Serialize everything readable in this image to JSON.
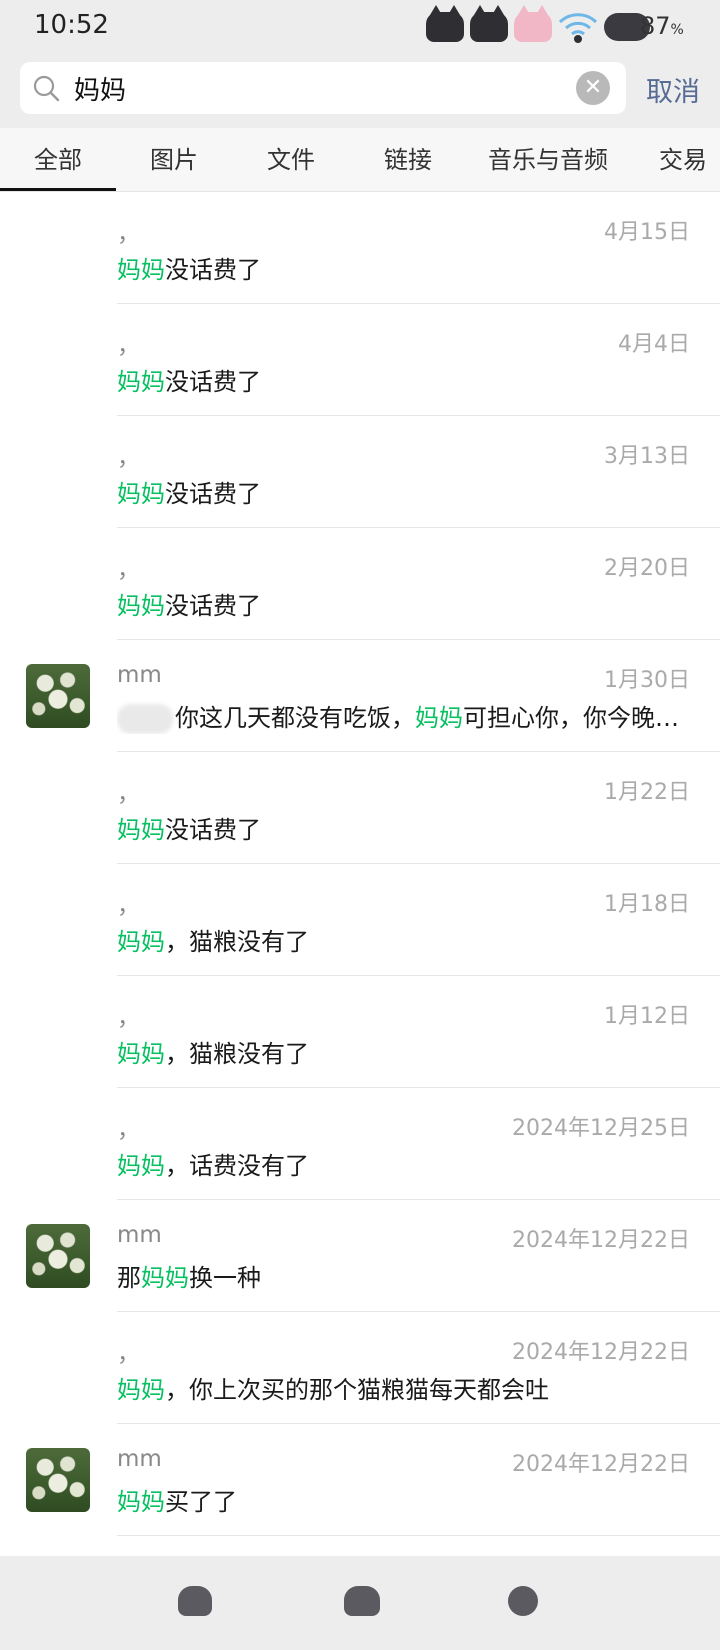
{
  "status": {
    "time": "10:52",
    "battery": "87",
    "battery_unit": "%"
  },
  "search": {
    "query": "妈妈",
    "placeholder": "",
    "cancel_label": "取消"
  },
  "tabs": [
    {
      "label": "全部",
      "active": true
    },
    {
      "label": "图片"
    },
    {
      "label": "文件"
    },
    {
      "label": "链接"
    },
    {
      "label": "音乐与音频"
    },
    {
      "label": "交易"
    }
  ],
  "results": [
    {
      "sender": "，",
      "date": "4月15日",
      "pre": "",
      "hl": "妈妈",
      "post": "没话费了",
      "avatar": false
    },
    {
      "sender": "，",
      "date": "4月4日",
      "pre": "",
      "hl": "妈妈",
      "post": "没话费了",
      "avatar": false
    },
    {
      "sender": "，",
      "date": "3月13日",
      "pre": "",
      "hl": "妈妈",
      "post": "没话费了",
      "avatar": false
    },
    {
      "sender": "，",
      "date": "2月20日",
      "pre": "",
      "hl": "妈妈",
      "post": "没话费了",
      "avatar": false
    },
    {
      "sender": "mm",
      "date": "1月30日",
      "pre": "你这几天都没有吃饭，",
      "hl": "妈妈",
      "post": "可担心你，你今晚…",
      "avatar": true,
      "blurred_prefix": true
    },
    {
      "sender": "，",
      "date": "1月22日",
      "pre": "",
      "hl": "妈妈",
      "post": "没话费了",
      "avatar": false
    },
    {
      "sender": "，",
      "date": "1月18日",
      "pre": "",
      "hl": "妈妈",
      "post": "，猫粮没有了",
      "avatar": false
    },
    {
      "sender": "，",
      "date": "1月12日",
      "pre": "",
      "hl": "妈妈",
      "post": "，猫粮没有了",
      "avatar": false
    },
    {
      "sender": "，",
      "date": "2024年12月25日",
      "pre": "",
      "hl": "妈妈",
      "post": "，话费没有了",
      "avatar": false
    },
    {
      "sender": "mm",
      "date": "2024年12月22日",
      "pre": "那",
      "hl": "妈妈",
      "post": "换一种",
      "avatar": true
    },
    {
      "sender": "，",
      "date": "2024年12月22日",
      "pre": "",
      "hl": "妈妈",
      "post": "，你上次买的那个猫粮猫每天都会吐",
      "avatar": false
    },
    {
      "sender": "mm",
      "date": "2024年12月22日",
      "pre": "",
      "hl": "妈妈",
      "post": "买了了",
      "avatar": true
    }
  ],
  "colors": {
    "highlight": "#07c160",
    "link": "#576b95",
    "chrome": "#ededed"
  },
  "icons": {
    "search": "search-icon",
    "clear": "clear-icon",
    "nav": [
      "nav-back-icon",
      "nav-home-icon",
      "nav-recent-icon"
    ]
  }
}
